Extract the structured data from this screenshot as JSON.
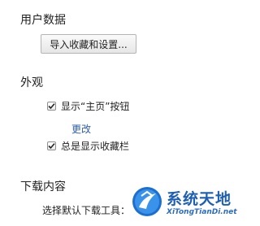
{
  "user_data": {
    "heading": "用户数据",
    "import_button_label": "导入收藏和设置..."
  },
  "appearance": {
    "heading": "外观",
    "show_home_button_label": "显示“主页”按钮",
    "show_home_button_checked": true,
    "change_link_label": "更改",
    "always_show_bookmarks_bar_label": "总是显示收藏栏",
    "always_show_bookmarks_bar_checked": true
  },
  "downloads": {
    "heading": "下载内容",
    "select_default_tool_label": "选择默认下载工具："
  },
  "watermark": {
    "title": "系统天地",
    "url": "XiTongTianDi.net",
    "icon": "system-site-logo-icon"
  },
  "colors": {
    "link": "#2a5db0",
    "watermark_blue": "#1c5fb3",
    "text": "#222222"
  }
}
